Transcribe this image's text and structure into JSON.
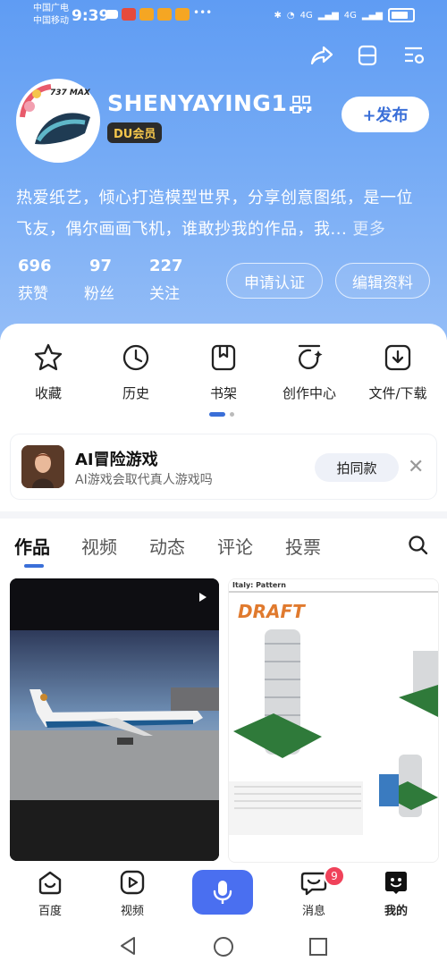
{
  "status_bar": {
    "carrier1": "中国广电",
    "carrier2": "中国移动",
    "time": "9:39",
    "net1": "4G",
    "net2": "4G"
  },
  "profile": {
    "username": "SHENYAYING1...",
    "vip_badge": "DU会员",
    "post_button": "+发布",
    "bio": "热爱纸艺，倾心打造模型世界，分享创意图纸，是一位飞友，偶尔画画飞机，谁敢抄我的作品，我...",
    "bio_more": "更多",
    "avatar_text": "737 MAX",
    "stats": [
      {
        "value": "696",
        "label": "获赞"
      },
      {
        "value": "97",
        "label": "粉丝"
      },
      {
        "value": "227",
        "label": "关注"
      }
    ],
    "apply_button": "申请认证",
    "edit_button": "编辑资料"
  },
  "quick_actions": [
    {
      "label": "收藏",
      "icon": "star-icon"
    },
    {
      "label": "历史",
      "icon": "clock-icon"
    },
    {
      "label": "书架",
      "icon": "bookshelf-icon"
    },
    {
      "label": "创作中心",
      "icon": "creation-icon"
    },
    {
      "label": "文件/下载",
      "icon": "download-icon"
    }
  ],
  "ad": {
    "title": "AI冒险游戏",
    "subtitle": "AI游戏会取代真人游戏吗",
    "button": "拍同款"
  },
  "tabs": [
    "作品",
    "视频",
    "动态",
    "评论",
    "投票"
  ],
  "thumbnails": {
    "doc_header": "Italy: Pattern",
    "doc_brand": "DRAFT"
  },
  "bottom_nav": [
    {
      "label": "百度"
    },
    {
      "label": "视频"
    },
    {
      "label": "消息",
      "badge": "9"
    },
    {
      "label": "我的"
    }
  ],
  "colors": {
    "accent": "#3a6fd8",
    "header_top": "#5f9cf3",
    "mic_button": "#4a6ff0",
    "badge": "#f0425a"
  }
}
